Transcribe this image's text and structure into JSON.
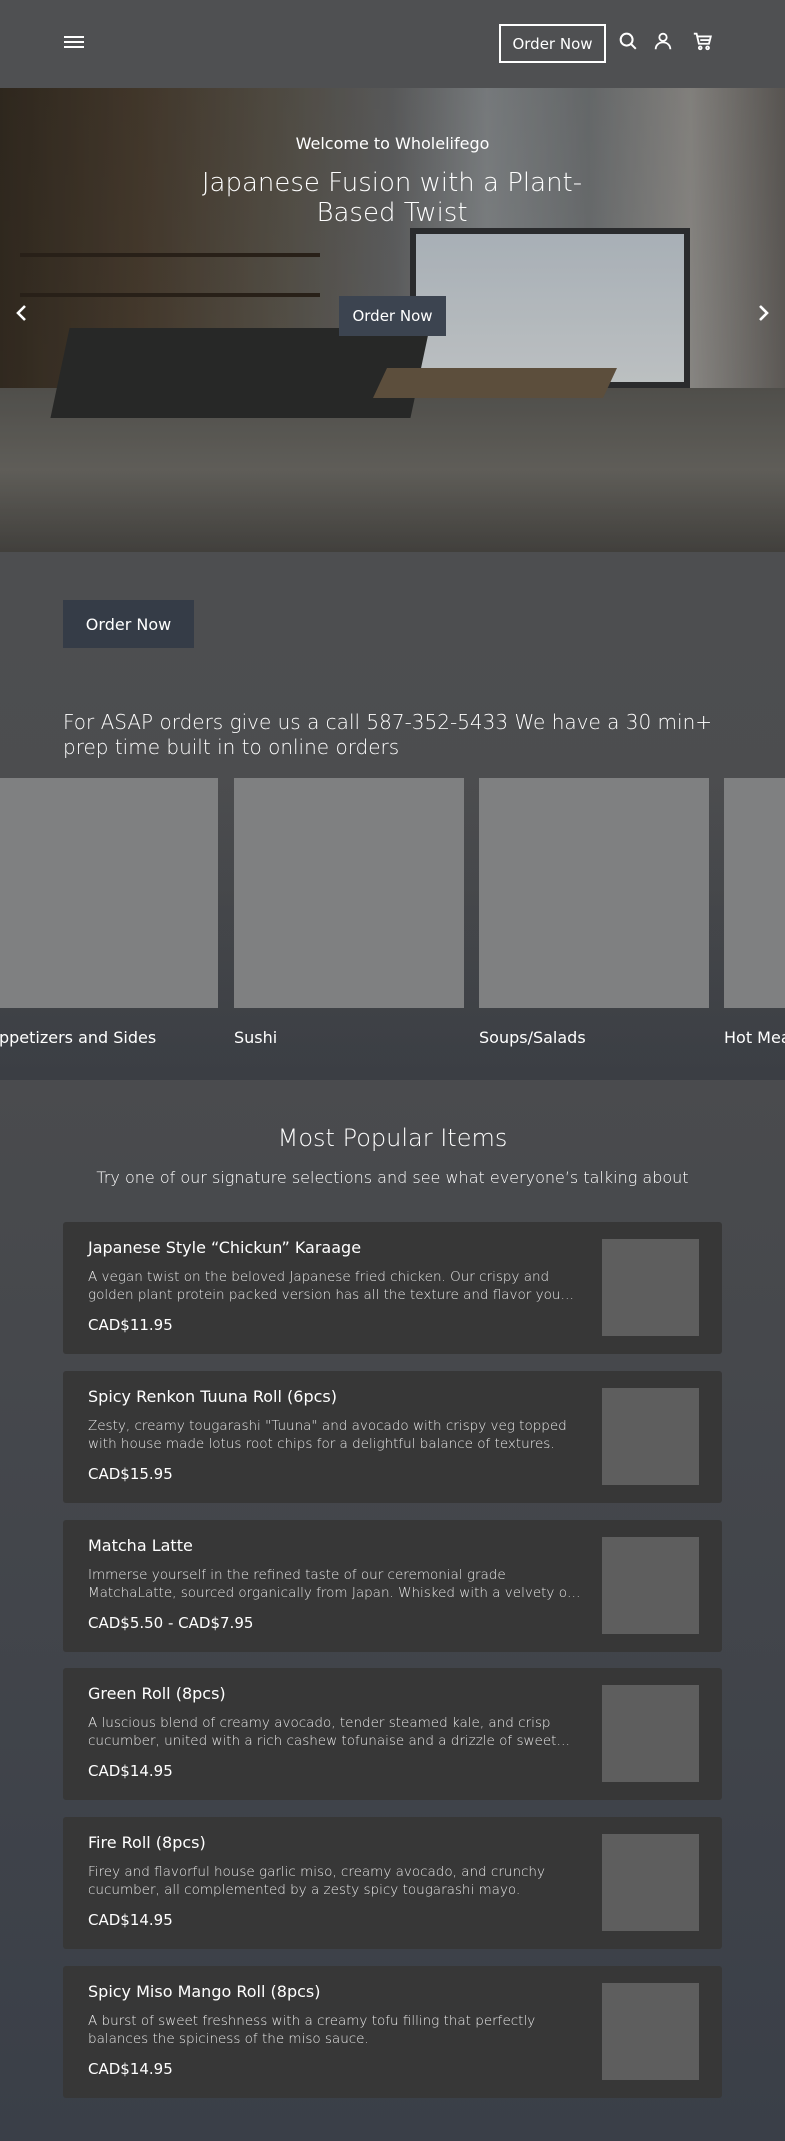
{
  "header": {
    "order_now": "Order Now",
    "icons": [
      "menu-icon",
      "search-icon",
      "user-icon",
      "cart-icon"
    ]
  },
  "hero": {
    "welcome": "Welcome to Wholelifego",
    "title": "Japanese Fusion with a Plant-Based Twist",
    "order_now": "Order Now"
  },
  "main": {
    "order_now": "Order Now",
    "asap_text": "For ASAP orders give us a call 587-352-5433 We have a 30 min+ prep time built in to online orders"
  },
  "categories": [
    {
      "label": "Appetizers and Sides"
    },
    {
      "label": "Sushi"
    },
    {
      "label": "Soups/Salads"
    },
    {
      "label": "Hot Meals"
    }
  ],
  "popular": {
    "title": "Most Popular Items",
    "subtitle": "Try one of our signature selections and see what everyone’s talking about",
    "items": [
      {
        "name": "Japanese Style “Chickun” Karaage",
        "desc": "A vegan twist on the beloved Japanese fried chicken. Our crispy and golden plant protein packed version has all the texture and flavor you crave.",
        "price": "CAD$11.95"
      },
      {
        "name": "Spicy Renkon Tuuna Roll (6pcs)",
        "desc": "Zesty, creamy tougarashi \"Tuuna\" and avocado with crispy veg topped with house made lotus root chips for a delightful balance of textures.",
        "price": "CAD$15.95"
      },
      {
        "name": "Matcha Latte",
        "desc": "Immerse yourself in the refined taste of our ceremonial grade MatchaLatte, sourced organically from Japan. Whisked with a velvety oat milk.",
        "price": "CAD$5.50 - CAD$7.95"
      },
      {
        "name": "Green Roll (8pcs)",
        "desc": "A luscious blend of creamy avocado, tender steamed kale, and crisp cucumber, united with a rich cashew tofunaise and a drizzle of sweet sauce.",
        "price": "CAD$14.95"
      },
      {
        "name": "Fire Roll (8pcs)",
        "desc": "Firey and flavorful house garlic miso, creamy avocado, and crunchy cucumber, all complemented by a zesty spicy tougarashi mayo.",
        "price": "CAD$14.95"
      },
      {
        "name": "Spicy Miso Mango Roll (8pcs)",
        "desc": "A burst of sweet freshness with a creamy tofu filling that perfectly balances the spiciness of the miso sauce.",
        "price": "CAD$14.95"
      }
    ]
  }
}
